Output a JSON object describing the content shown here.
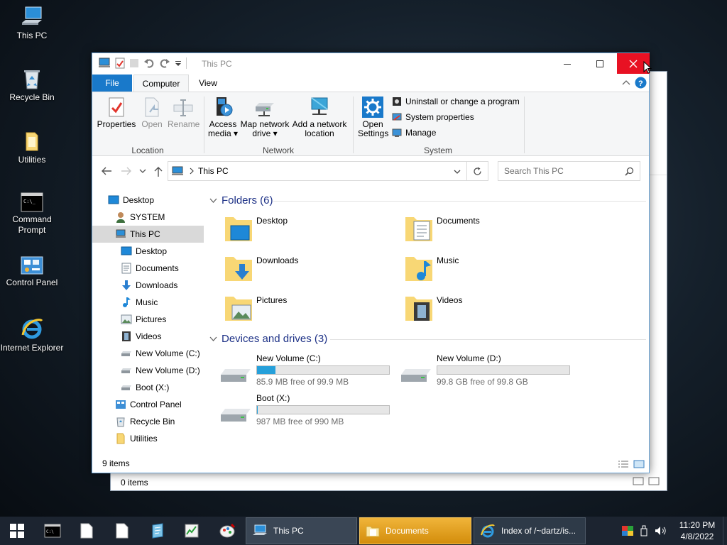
{
  "desktop": {
    "icons": [
      {
        "label": "This PC"
      },
      {
        "label": "Recycle Bin"
      },
      {
        "label": "Utilities"
      },
      {
        "label": "Command Prompt"
      },
      {
        "label": "Control Panel"
      },
      {
        "label": "Internet Explorer"
      }
    ]
  },
  "bg_window": {
    "status": "0 items"
  },
  "window": {
    "title": "This PC",
    "tabs": {
      "file": "File",
      "computer": "Computer",
      "view": "View"
    },
    "ribbon": {
      "location": {
        "properties": "Properties",
        "open": "Open",
        "rename": "Rename",
        "label": "Location"
      },
      "network": {
        "access_media": "Access media",
        "map_network_drive": "Map network drive",
        "add_network_location": "Add a network location",
        "label": "Network"
      },
      "system": {
        "open_settings": "Open Settings",
        "uninstall": "Uninstall or change a program",
        "system_properties": "System properties",
        "manage": "Manage",
        "label": "System"
      }
    },
    "address": {
      "path": "This PC",
      "search_placeholder": "Search This PC"
    },
    "nav": [
      {
        "label": "Desktop"
      },
      {
        "label": "SYSTEM"
      },
      {
        "label": "This PC"
      },
      {
        "label": "Desktop"
      },
      {
        "label": "Documents"
      },
      {
        "label": "Downloads"
      },
      {
        "label": "Music"
      },
      {
        "label": "Pictures"
      },
      {
        "label": "Videos"
      },
      {
        "label": "New Volume (C:)"
      },
      {
        "label": "New Volume (D:)"
      },
      {
        "label": "Boot (X:)"
      },
      {
        "label": "Control Panel"
      },
      {
        "label": "Recycle Bin"
      },
      {
        "label": "Utilities"
      }
    ],
    "folders_header": "Folders (6)",
    "folders": [
      {
        "name": "Desktop"
      },
      {
        "name": "Documents"
      },
      {
        "name": "Downloads"
      },
      {
        "name": "Music"
      },
      {
        "name": "Pictures"
      },
      {
        "name": "Videos"
      }
    ],
    "drives_header": "Devices and drives (3)",
    "drives": [
      {
        "name": "New Volume (C:)",
        "free": "85.9 MB free of 99.9 MB",
        "used_fraction": 0.14
      },
      {
        "name": "New Volume (D:)",
        "free": "99.8 GB free of 99.8 GB",
        "used_fraction": 0.0
      },
      {
        "name": "Boot (X:)",
        "free": "987 MB free of 990 MB",
        "used_fraction": 0.003
      }
    ],
    "status": "9 items"
  },
  "taskbar": {
    "tasks": [
      {
        "label": "This PC"
      },
      {
        "label": "Documents"
      },
      {
        "label": "Index of /~dartz/is..."
      }
    ],
    "time": "11:20 PM",
    "date": "4/8/2022"
  },
  "colors": {
    "accent": "#1979ca",
    "close_red": "#e81123",
    "progress": "#26a0da",
    "section_heading": "#1e3287"
  }
}
